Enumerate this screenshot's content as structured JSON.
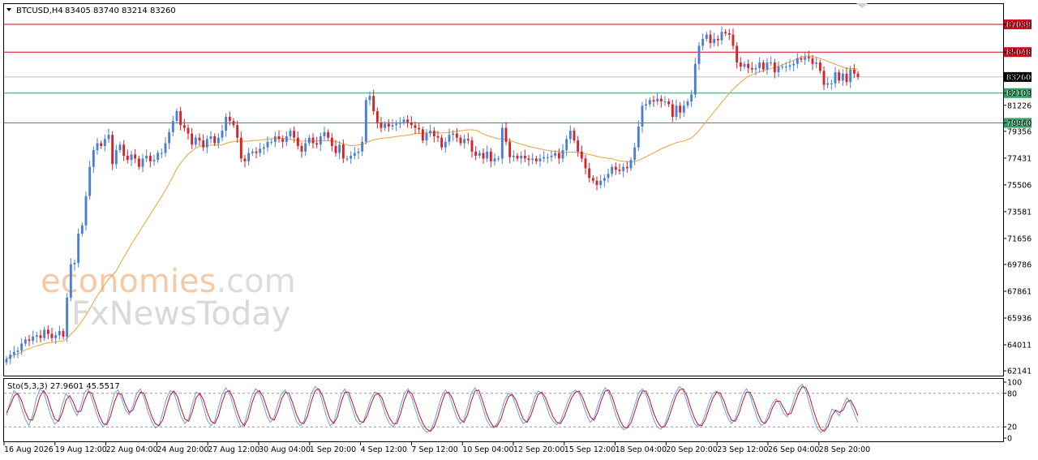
{
  "chart_data": {
    "type": "candlestick",
    "symbol_label": "BTCUSD,H4",
    "ohlc_label": "83405 83740 83214 83260",
    "price_ylim": [
      61800,
      88500
    ],
    "price_ticks": [
      "87039",
      "85048",
      "83260",
      "82103",
      "81226",
      "79960",
      "79356",
      "77431",
      "75506",
      "73581",
      "71656",
      "69786",
      "67861",
      "65936",
      "64011",
      "62141"
    ],
    "levels": [
      {
        "value": 87039,
        "label": "87039",
        "color": "#d9001b",
        "boxed": true
      },
      {
        "value": 85048,
        "label": "85048",
        "color": "#d9001b",
        "boxed": true
      },
      {
        "value": 82103,
        "label": "82103",
        "color": "#2e9f62",
        "boxed": true
      },
      {
        "value": 79960,
        "label": "79960",
        "color": "#2e9f62",
        "boxed": true
      },
      {
        "value": 83260,
        "label": "83260",
        "color": "#000000",
        "boxed": true,
        "line_color": "#bfbfbf"
      }
    ],
    "x_labels": [
      "16 Aug 2026",
      "19 Aug 12:00",
      "22 Aug 04:00",
      "24 Aug 20:00",
      "27 Aug 12:00",
      "30 Aug 04:00",
      "1 Sep 20:00",
      "4 Sep 12:00",
      "7 Sep 12:00",
      "10 Sep 04:00",
      "12 Sep 20:00",
      "15 Sep 12:00",
      "18 Sep 04:00",
      "20 Sep 20:00",
      "23 Sep 12:00",
      "26 Sep 04:00",
      "28 Sep 20:00"
    ],
    "closes": [
      63000,
      63300,
      63500,
      63600,
      64100,
      64400,
      64300,
      64600,
      64700,
      64500,
      65100,
      64800,
      64500,
      64700,
      65000,
      64600,
      67400,
      69800,
      69900,
      72000,
      72600,
      74700,
      76800,
      78000,
      78500,
      78300,
      78800,
      79100,
      77000,
      78000,
      78400,
      77600,
      77300,
      77700,
      77400,
      76800,
      77400,
      77600,
      77200,
      77300,
      77800,
      77800,
      78500,
      79300,
      80100,
      80800,
      79800,
      79600,
      79200,
      78400,
      78900,
      78700,
      78200,
      78800,
      79000,
      78500,
      78900,
      79400,
      80400,
      80100,
      79800,
      78900,
      77400,
      77200,
      77800,
      77900,
      77800,
      78100,
      78200,
      78600,
      78600,
      79000,
      78800,
      78600,
      79000,
      79400,
      78900,
      78300,
      77900,
      78500,
      78900,
      78500,
      78400,
      79000,
      79300,
      78900,
      78300,
      77800,
      78400,
      77400,
      77400,
      77600,
      77800,
      77900,
      78600,
      81600,
      81900,
      80800,
      80000,
      79600,
      79900,
      79700,
      79800,
      79900,
      80000,
      80200,
      80000,
      79800,
      79600,
      79500,
      78700,
      79200,
      79400,
      79000,
      78900,
      78200,
      78600,
      79100,
      79200,
      78900,
      78500,
      78800,
      78700,
      77900,
      77600,
      77800,
      77400,
      77900,
      77200,
      77400,
      77400,
      79600,
      78600,
      77500,
      77600,
      77400,
      77600,
      77400,
      77300,
      77400,
      77200,
      77400,
      77500,
      77500,
      77600,
      77800,
      77400,
      78000,
      78800,
      79400,
      78700,
      77900,
      77400,
      76700,
      76000,
      75800,
      75500,
      75800,
      76000,
      76300,
      76800,
      76600,
      76500,
      76800,
      76700,
      77300,
      78200,
      79700,
      81200,
      81300,
      81600,
      81500,
      81700,
      81500,
      81500,
      81300,
      80400,
      81200,
      80700,
      81200,
      81500,
      82000,
      84200,
      85500,
      86000,
      86300,
      85700,
      86000,
      85900,
      86500,
      86400,
      86300,
      85500,
      84300,
      84000,
      84200,
      83900,
      83800,
      83900,
      84300,
      83800,
      84300,
      84300,
      83600,
      84000,
      84000,
      84000,
      84100,
      84200,
      84600,
      84500,
      84700,
      84600,
      84200,
      84300,
      83700,
      82700,
      82800,
      82800,
      83600,
      83000,
      83500,
      82900,
      83800,
      83500,
      83260
    ],
    "ma_ylim_note": "",
    "stoch_label": "Sto(5,3,3) 27.9601 45.5517",
    "stoch_ylim": [
      0,
      100
    ],
    "stoch_ticks": [
      "100",
      "80",
      "20",
      "0"
    ],
    "stoch_main": [
      40,
      65,
      85,
      78,
      55,
      35,
      22,
      40,
      70,
      88,
      82,
      60,
      38,
      25,
      32,
      60,
      80,
      70,
      52,
      40,
      58,
      82,
      88,
      70,
      48,
      30,
      20,
      28,
      55,
      80,
      86,
      70,
      50,
      42,
      58,
      80,
      88,
      72,
      48,
      30,
      18,
      22,
      45,
      70,
      85,
      82,
      60,
      38,
      26,
      35,
      62,
      82,
      78,
      55,
      32,
      22,
      30,
      55,
      78,
      90,
      80,
      58,
      36,
      20,
      25,
      50,
      75,
      88,
      82,
      62,
      40,
      28,
      38,
      62,
      80,
      86,
      72,
      50,
      30,
      22,
      30,
      55,
      80,
      92,
      86,
      64,
      40,
      22,
      28,
      52,
      78,
      88,
      74,
      52,
      32,
      24,
      30,
      50,
      70,
      82,
      80,
      62,
      40,
      26,
      20,
      32,
      58,
      80,
      88,
      72,
      50,
      30,
      18,
      10,
      14,
      28,
      52,
      74,
      86,
      78,
      58,
      38,
      26,
      32,
      56,
      80,
      90,
      78,
      56,
      34,
      22,
      18,
      26,
      46,
      68,
      80,
      76,
      58,
      38,
      26,
      30,
      50,
      72,
      84,
      80,
      62,
      42,
      30,
      24,
      30,
      48,
      66,
      80,
      86,
      80,
      62,
      42,
      28,
      36,
      58,
      78,
      90,
      82,
      60,
      38,
      22,
      15,
      20,
      38,
      60,
      80,
      88,
      78,
      56,
      34,
      20,
      16,
      24,
      44,
      66,
      82,
      92,
      86,
      64,
      42,
      26,
      20,
      26,
      44,
      66,
      80,
      84,
      74,
      54,
      36,
      26,
      34,
      56,
      78,
      88,
      76,
      54,
      34,
      22,
      28,
      46,
      62,
      70,
      60,
      44,
      38,
      52,
      74,
      90,
      96,
      84,
      60,
      36,
      18,
      10,
      16,
      32,
      52,
      48,
      40,
      58,
      72,
      62,
      44,
      28
    ],
    "stoch_signal": [
      45,
      58,
      75,
      80,
      68,
      48,
      33,
      32,
      52,
      75,
      85,
      74,
      52,
      34,
      30,
      45,
      68,
      76,
      64,
      47,
      48,
      68,
      83,
      80,
      60,
      40,
      26,
      24,
      40,
      64,
      80,
      78,
      60,
      46,
      50,
      68,
      82,
      80,
      60,
      40,
      26,
      22,
      32,
      55,
      76,
      84,
      74,
      52,
      34,
      30,
      48,
      72,
      80,
      68,
      46,
      30,
      26,
      40,
      64,
      82,
      85,
      70,
      48,
      30,
      22,
      36,
      62,
      80,
      85,
      74,
      54,
      36,
      32,
      48,
      70,
      82,
      80,
      62,
      42,
      28,
      26,
      40,
      66,
      85,
      88,
      76,
      54,
      34,
      26,
      38,
      64,
      82,
      82,
      64,
      44,
      30,
      28,
      40,
      60,
      76,
      80,
      72,
      52,
      36,
      26,
      26,
      44,
      68,
      84,
      80,
      62,
      42,
      26,
      16,
      12,
      20,
      38,
      62,
      80,
      82,
      70,
      50,
      34,
      28,
      42,
      66,
      84,
      86,
      68,
      46,
      30,
      20,
      22,
      34,
      56,
      74,
      78,
      68,
      50,
      34,
      28,
      40,
      60,
      78,
      82,
      72,
      54,
      38,
      28,
      26,
      38,
      56,
      72,
      82,
      84,
      72,
      54,
      38,
      32,
      46,
      68,
      84,
      86,
      72,
      50,
      32,
      20,
      18,
      28,
      48,
      70,
      84,
      84,
      68,
      46,
      30,
      20,
      20,
      34,
      54,
      74,
      86,
      88,
      76,
      54,
      36,
      24,
      22,
      34,
      54,
      72,
      82,
      80,
      66,
      46,
      32,
      30,
      44,
      66,
      82,
      82,
      66,
      46,
      30,
      26,
      36,
      54,
      66,
      66,
      54,
      42,
      44,
      62,
      80,
      92,
      90,
      74,
      50,
      30,
      16,
      12,
      22,
      40,
      50,
      46,
      50,
      64,
      68,
      56,
      40
    ]
  }
}
